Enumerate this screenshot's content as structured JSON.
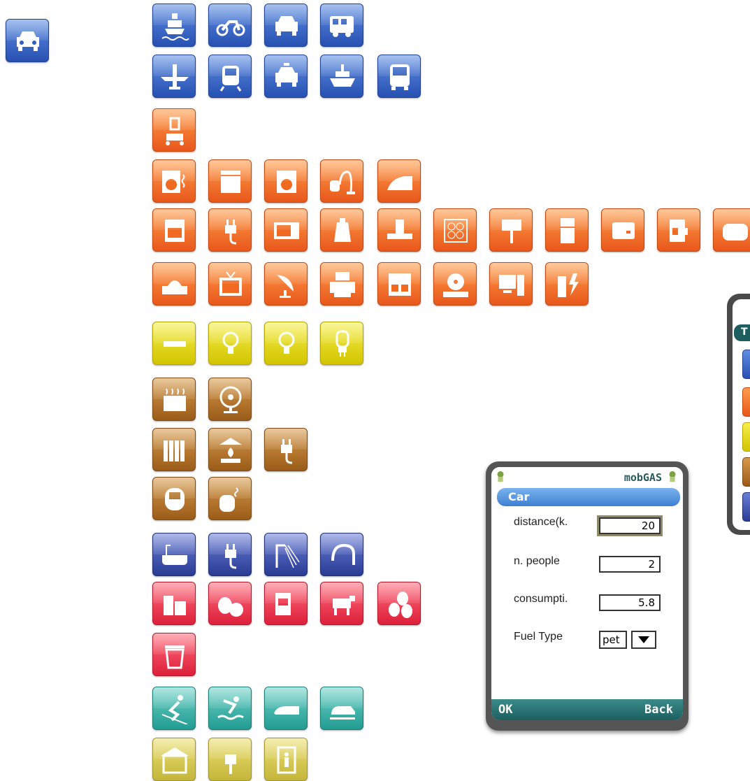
{
  "app": {
    "title": "mobGAS",
    "form_header": "Car",
    "fields": [
      {
        "label": "distance(k.",
        "value": "20"
      },
      {
        "label": "n. people",
        "value": "2"
      },
      {
        "label": "consumpti.",
        "value": "5.8"
      }
    ],
    "fuel": {
      "label": "Fuel Type",
      "value": "pet"
    },
    "softkeys": {
      "left": "OK",
      "right": "Back"
    },
    "second_phone_header_partial": "T"
  },
  "icons": {
    "selected": "car-icon",
    "transport": [
      "ship-icon",
      "motorbike-icon",
      "car-icon",
      "camper-van-icon",
      "airplane-icon",
      "train-icon",
      "taxi-icon",
      "ferry-icon",
      "bus-icon"
    ],
    "electric_orange": [
      "lawnmower-icon",
      "washing-dryer-icon",
      "dishwasher-icon",
      "washing-machine-icon",
      "vacuum-cleaner-icon",
      "iron-icon",
      "oven-icon",
      "plug-icon",
      "microwave-icon",
      "kettle-icon",
      "cooker-hood-icon",
      "hob-icon",
      "grill-icon",
      "fridge-icon",
      "bread-maker-icon",
      "coffee-machine-icon",
      "toaster-icon",
      "dvd-player-icon",
      "tv-icon",
      "satellite-dish-icon",
      "printer-icon",
      "stereo-icon",
      "cd-player-icon",
      "computer-icon",
      "battery-charger-icon"
    ],
    "lighting_yellow": [
      "fluorescent-tube-icon",
      "light-bulb-icon",
      "energy-saver-bulb-icon",
      "halogen-bulb-icon"
    ],
    "heating_brown": [
      "heater-icon",
      "fan-icon",
      "radiator-icon",
      "fireplace-icon",
      "plug-icon",
      "dehumidifier-icon",
      "humidifier-icon"
    ],
    "water_navy": [
      "bathtub-icon",
      "plug-icon",
      "shower-icon",
      "hairdryer-icon"
    ],
    "food_red": [
      "drinks-icon",
      "fruit-vegetables-icon",
      "packaged-food-icon",
      "cow-icon",
      "eggs-icon",
      "trash-bin-icon"
    ],
    "leisure_teal": [
      "skiing-icon",
      "swimming-icon",
      "jetski-icon",
      "snowmobile-icon"
    ],
    "home_olive": [
      "garage-icon",
      "socket-icon",
      "elevator-icon"
    ]
  },
  "colors": {
    "blue": "#2f5ec0",
    "orange": "#f06a22",
    "yellow": "#e3d81a",
    "brown": "#b17429",
    "navy": "#3647a8",
    "red": "#ec3448",
    "teal": "#2fa89d",
    "olive": "#d6c94c",
    "phone_bar": "#1d5f5f",
    "header": "#5a98e2"
  }
}
